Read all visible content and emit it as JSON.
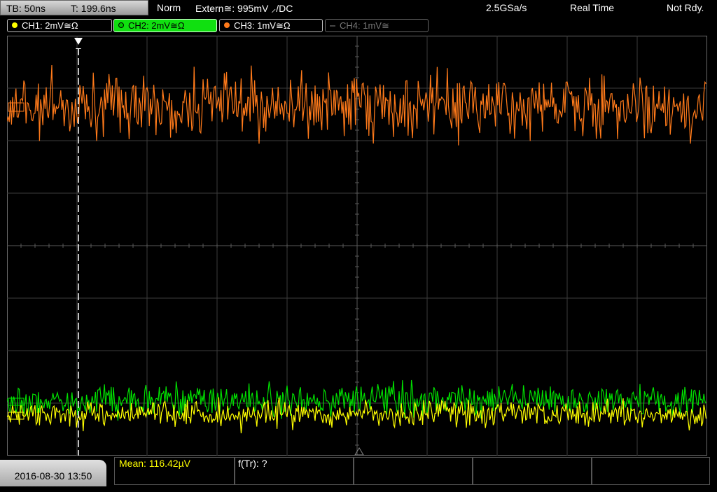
{
  "header": {
    "timebase": "TB: 50ns",
    "trigger_time": "T: 199.6ns",
    "mode": "Norm",
    "trigger_source": "Extern≅: 995mV ⸝/DC",
    "sample_rate": "2.5GSa/s",
    "acquisition": "Real Time",
    "status": "Not Rdy."
  },
  "channels": [
    {
      "label": "CH1: 2mV≅Ω",
      "color": "#ffff00",
      "state": "on"
    },
    {
      "label": "CH2: 2mV≅Ω",
      "color": "#00e000",
      "state": "selected"
    },
    {
      "label": "CH3: 1mV≅Ω",
      "color": "#ff7a1a",
      "state": "on"
    },
    {
      "label": "CH4: 1mV≅",
      "color": "#666666",
      "state": "off"
    }
  ],
  "footer": {
    "datetime": "2016-08-30 13:50",
    "measurement_1": "Mean: 116.42µV",
    "measurement_2": "f(Tr): ?"
  },
  "colors": {
    "grid": "#555555",
    "trigger_marker": "#ffffff"
  }
}
